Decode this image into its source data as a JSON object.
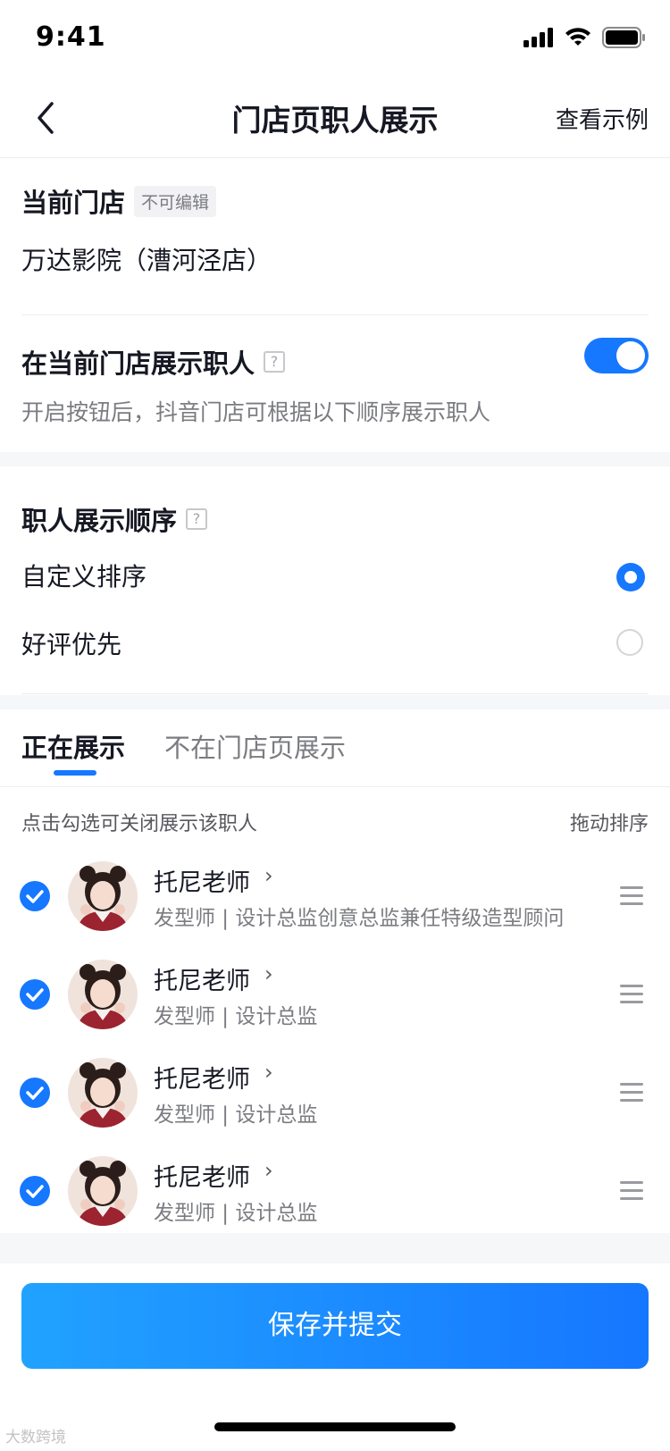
{
  "status_bar": {
    "time": "9:41"
  },
  "nav": {
    "title": "门店页职人展示",
    "right_link": "查看示例"
  },
  "store": {
    "label": "当前门店",
    "tag": "不可编辑",
    "name": "万达影院（漕河泾店）"
  },
  "display_toggle": {
    "label": "在当前门店展示职人",
    "help": "?",
    "description": "开启按钮后，抖音门店可根据以下顺序展示职人",
    "enabled": true
  },
  "order": {
    "label": "职人展示顺序",
    "help": "?",
    "options": [
      {
        "label": "自定义排序",
        "selected": true
      },
      {
        "label": "好评优先",
        "selected": false
      }
    ]
  },
  "tabs": [
    {
      "label": "正在展示",
      "active": true
    },
    {
      "label": "不在门店页展示",
      "active": false
    }
  ],
  "list_header": {
    "hint": "点击勾选可关闭展示该职人",
    "sort": "拖动排序"
  },
  "staff": [
    {
      "name": "托尼老师",
      "role": "发型师 | 设计总监创意总监兼任特级造型顾问",
      "checked": true
    },
    {
      "name": "托尼老师",
      "role": "发型师 | 设计总监",
      "checked": true
    },
    {
      "name": "托尼老师",
      "role": "发型师 | 设计总监",
      "checked": true
    },
    {
      "name": "托尼老师",
      "role": "发型师 | 设计总监",
      "checked": true
    }
  ],
  "footer": {
    "save_label": "保存并提交"
  },
  "watermark": "大数跨境",
  "colors": {
    "accent": "#1677ff",
    "text": "#161823",
    "secondary": "#7b7c81",
    "band": "#f6f7f9"
  }
}
